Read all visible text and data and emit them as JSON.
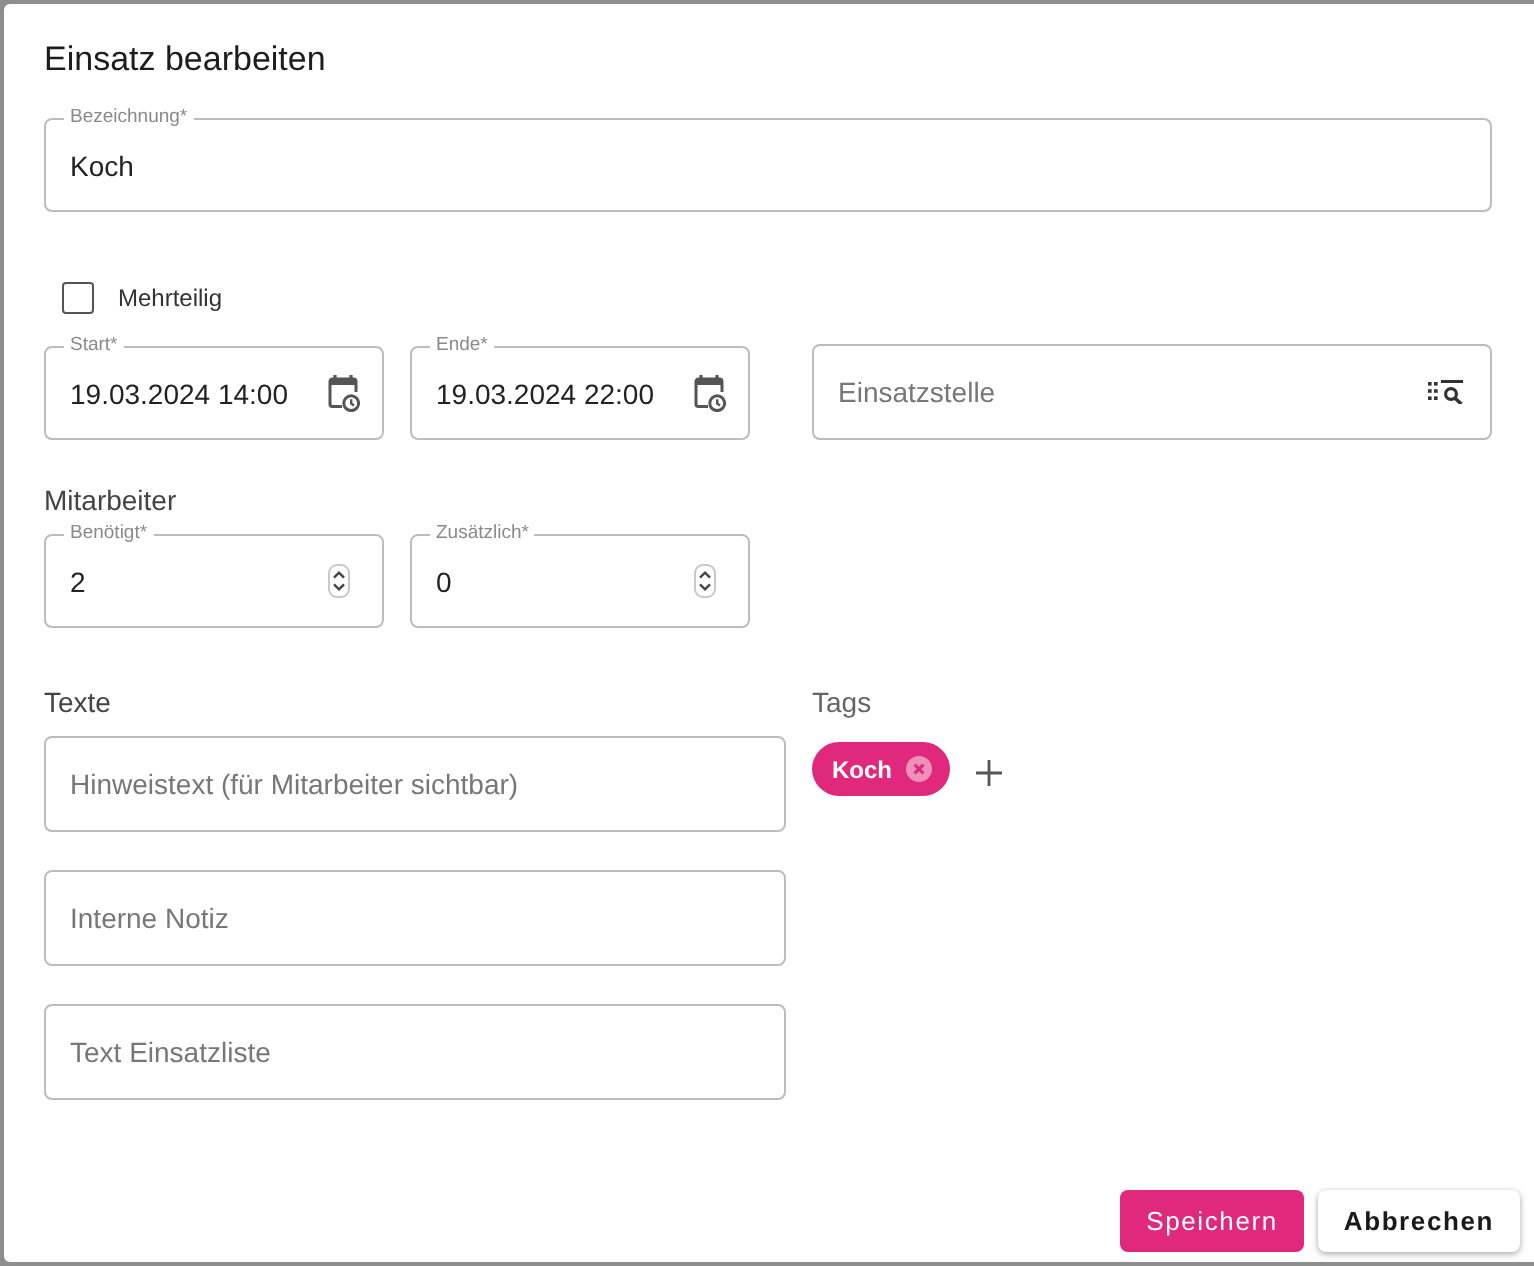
{
  "dialog": {
    "title": "Einsatz bearbeiten"
  },
  "name_field": {
    "label": "Bezeichnung*",
    "value": "Koch"
  },
  "multipart": {
    "label": "Mehrteilig",
    "checked": false
  },
  "dates": [
    {
      "label": "Start*",
      "value": "19.03.2024 14:00"
    },
    {
      "label": "Ende*",
      "value": "19.03.2024 22:00"
    }
  ],
  "location": {
    "placeholder": "Einsatzstelle"
  },
  "staff": {
    "heading": "Mitarbeiter",
    "fields": [
      {
        "label": "Benötigt*",
        "value": "2"
      },
      {
        "label": "Zusätzlich*",
        "value": "0"
      }
    ]
  },
  "texts": {
    "heading": "Texte",
    "fields": [
      {
        "placeholder": "Hinweistext (für Mitarbeiter sichtbar)"
      },
      {
        "placeholder": "Interne Notiz"
      },
      {
        "placeholder": "Text Einsatzliste"
      }
    ]
  },
  "tags": {
    "heading": "Tags",
    "items": [
      {
        "label": "Koch"
      }
    ]
  },
  "buttons": [
    {
      "label": "Speichern",
      "kind": "primary"
    },
    {
      "label": "Abbrechen",
      "kind": "secondary"
    }
  ]
}
